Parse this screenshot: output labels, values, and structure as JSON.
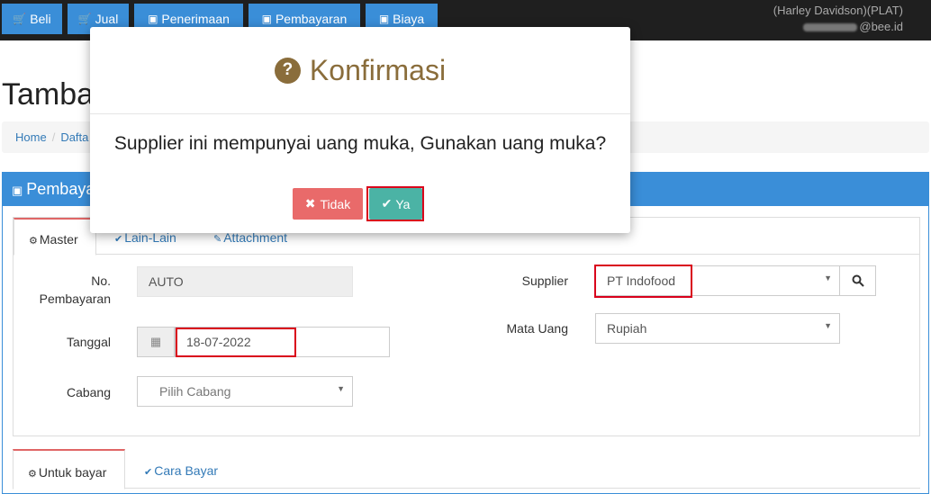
{
  "nav": {
    "buttons": [
      {
        "label": "Beli",
        "icon": "cart-icon"
      },
      {
        "label": "Jual",
        "icon": "cart-icon"
      },
      {
        "label": "Penerimaan",
        "icon": "money-icon"
      },
      {
        "label": "Pembayaran",
        "icon": "money-icon"
      },
      {
        "label": "Biaya",
        "icon": "money-icon"
      }
    ],
    "company": "(Harley Davidson)(PLAT)",
    "email_suffix": "@bee.id"
  },
  "page": {
    "title": "Tamba",
    "breadcrumb": [
      "Home",
      "Dafta"
    ]
  },
  "panel": {
    "title": "Pembaya"
  },
  "tabs": {
    "master": "Master",
    "lain": "Lain-Lain",
    "attachment": "Attachment"
  },
  "form": {
    "no_pembayaran_label_1": "No.",
    "no_pembayaran_label_2": "Pembayaran",
    "no_pembayaran_value": "AUTO",
    "tanggal_label": "Tanggal",
    "tanggal_value": "18-07-2022",
    "cabang_label": "Cabang",
    "cabang_placeholder": "Pilih Cabang",
    "supplier_label": "Supplier",
    "supplier_value": "PT Indofood",
    "mata_uang_label": "Mata Uang",
    "mata_uang_value": "Rupiah"
  },
  "tabs2": {
    "untuk_bayar": "Untuk bayar",
    "cara_bayar": "Cara Bayar"
  },
  "modal": {
    "title": "Konfirmasi",
    "message": "Supplier ini mempunyai uang muka, Gunakan uang muka?",
    "no_label": "Tidak",
    "yes_label": "Ya"
  },
  "colors": {
    "nav_button": "#3a8ed8",
    "modal_title": "#8a6d3b",
    "no_button": "#e96a6a",
    "yes_button": "#4bb3a5",
    "highlight": "#d9001b"
  }
}
